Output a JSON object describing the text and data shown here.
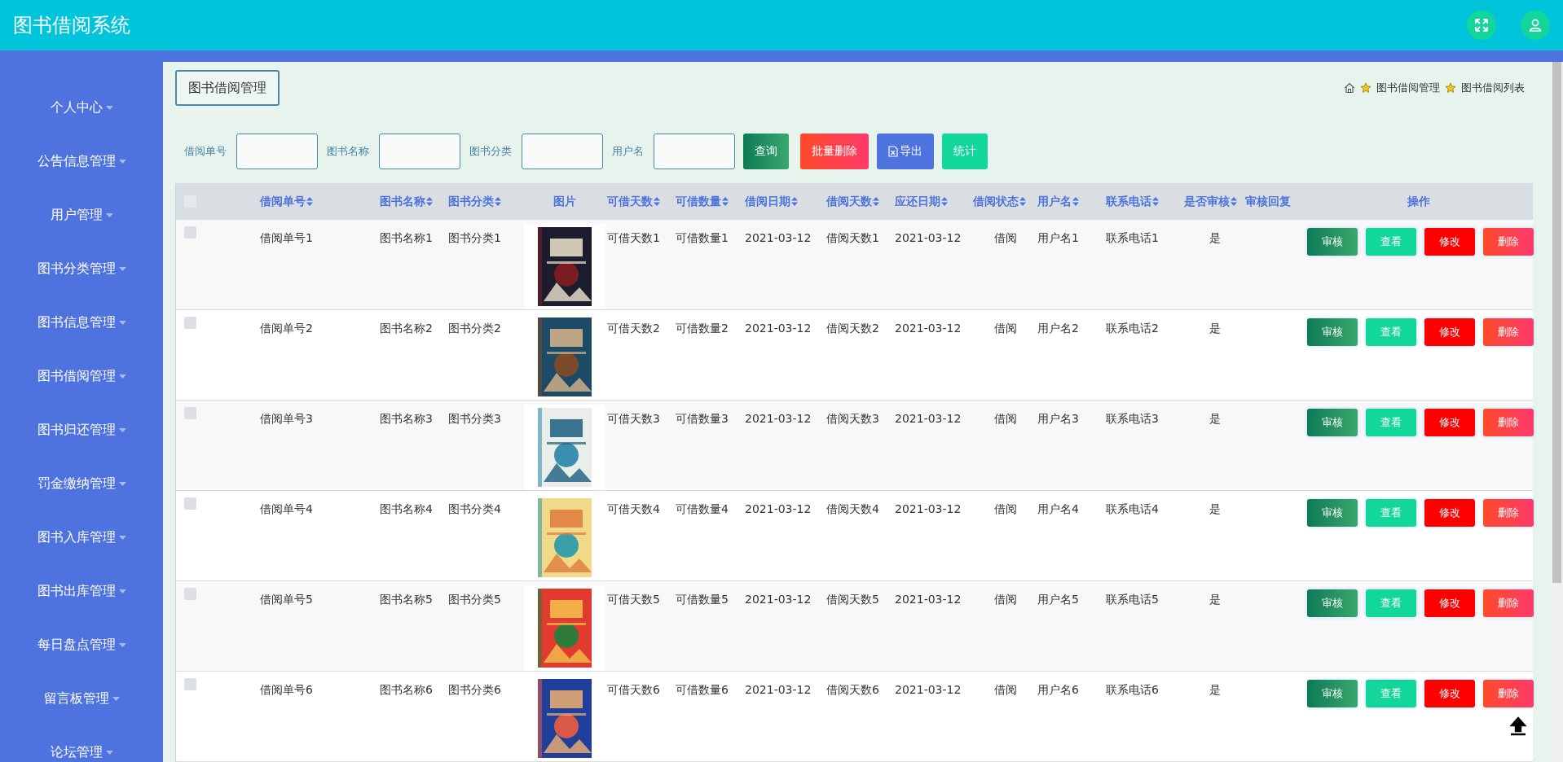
{
  "app": {
    "title": "图书借阅系统"
  },
  "sidebar": {
    "items": [
      {
        "label": "个人中心"
      },
      {
        "label": "公告信息管理"
      },
      {
        "label": "用户管理"
      },
      {
        "label": "图书分类管理"
      },
      {
        "label": "图书信息管理"
      },
      {
        "label": "图书借阅管理"
      },
      {
        "label": "图书归还管理"
      },
      {
        "label": "罚金缴纳管理"
      },
      {
        "label": "图书入库管理"
      },
      {
        "label": "图书出库管理"
      },
      {
        "label": "每日盘点管理"
      },
      {
        "label": "留言板管理"
      },
      {
        "label": "论坛管理"
      }
    ]
  },
  "page": {
    "title": "图书借阅管理",
    "breadcrumb": [
      "图书借阅管理",
      "图书借阅列表"
    ]
  },
  "search": {
    "fields": [
      {
        "label": "借阅单号"
      },
      {
        "label": "图书名称"
      },
      {
        "label": "图书分类"
      },
      {
        "label": "用户名"
      }
    ],
    "buttons": [
      {
        "label": "查询",
        "kind": "query"
      },
      {
        "label": "批量删除",
        "kind": "batch-delete"
      },
      {
        "label": "导出",
        "kind": "export"
      },
      {
        "label": "统计",
        "kind": "stats"
      }
    ]
  },
  "table": {
    "header_checked": false,
    "columns": [
      {
        "kind": "text",
        "label": "借阅单号",
        "sortable": true
      },
      {
        "kind": "text",
        "label": "图书名称",
        "sortable": true
      },
      {
        "kind": "text",
        "label": "图书分类",
        "sortable": true
      },
      {
        "label": "图片",
        "sortable": false
      },
      {
        "kind": "text",
        "label": "可借天数",
        "sortable": true
      },
      {
        "kind": "text",
        "label": "可借数量",
        "sortable": true
      },
      {
        "kind": "text",
        "label": "借阅日期",
        "sortable": true
      },
      {
        "kind": "text",
        "label": "借阅天数",
        "sortable": true
      },
      {
        "kind": "text",
        "label": "应还日期",
        "sortable": true
      },
      {
        "kind": "text",
        "label": "借阅状态",
        "sortable": true
      },
      {
        "kind": "text",
        "label": "用户名",
        "sortable": true
      },
      {
        "kind": "text",
        "label": "联系电话",
        "sortable": true
      },
      {
        "kind": "text",
        "label": "是否审核",
        "sortable": true
      },
      {
        "kind": "text",
        "label": "审核回复",
        "sortable": false
      },
      {
        "kind": "actions",
        "label": "操作",
        "sortable": false
      }
    ],
    "rows": [
      {
        "checked": false,
        "cells": [
          "借阅单号1",
          "图书名称1",
          "图书分类1",
          {
            "kind": "picture"
          },
          "可借天数1",
          "可借数量1",
          "2021-03-12",
          "借阅天数1",
          "2021-03-12",
          "借阅",
          "用户名1",
          "联系电话1",
          "是"
        ],
        "actions": [
          {
            "label": "审核",
            "kind": "audit"
          },
          {
            "label": "查看",
            "kind": "view"
          },
          {
            "label": "修改",
            "kind": "edit"
          },
          {
            "label": "删除",
            "kind": "delete"
          }
        ]
      },
      {
        "checked": false,
        "cells": [
          "借阅单号2",
          "图书名称2",
          "图书分类2",
          {
            "kind": "picture"
          },
          "可借天数2",
          "可借数量2",
          "2021-03-12",
          "借阅天数2",
          "2021-03-12",
          "借阅",
          "用户名2",
          "联系电话2",
          "是"
        ],
        "actions": [
          {
            "label": "审核",
            "kind": "audit"
          },
          {
            "label": "查看",
            "kind": "view"
          },
          {
            "label": "修改",
            "kind": "edit"
          },
          {
            "label": "删除",
            "kind": "delete"
          }
        ]
      },
      {
        "checked": false,
        "cells": [
          "借阅单号3",
          "图书名称3",
          "图书分类3",
          {
            "kind": "picture"
          },
          "可借天数3",
          "可借数量3",
          "2021-03-12",
          "借阅天数3",
          "2021-03-12",
          "借阅",
          "用户名3",
          "联系电话3",
          "是"
        ],
        "actions": [
          {
            "label": "审核",
            "kind": "audit"
          },
          {
            "label": "查看",
            "kind": "view"
          },
          {
            "label": "修改",
            "kind": "edit"
          },
          {
            "label": "删除",
            "kind": "delete"
          }
        ]
      },
      {
        "checked": false,
        "cells": [
          "借阅单号4",
          "图书名称4",
          "图书分类4",
          {
            "kind": "picture"
          },
          "可借天数4",
          "可借数量4",
          "2021-03-12",
          "借阅天数4",
          "2021-03-12",
          "借阅",
          "用户名4",
          "联系电话4",
          "是"
        ],
        "actions": [
          {
            "label": "审核",
            "kind": "audit"
          },
          {
            "label": "查看",
            "kind": "view"
          },
          {
            "label": "修改",
            "kind": "edit"
          },
          {
            "label": "删除",
            "kind": "delete"
          }
        ]
      },
      {
        "checked": false,
        "cells": [
          "借阅单号5",
          "图书名称5",
          "图书分类5",
          {
            "kind": "picture"
          },
          "可借天数5",
          "可借数量5",
          "2021-03-12",
          "借阅天数5",
          "2021-03-12",
          "借阅",
          "用户名5",
          "联系电话5",
          "是"
        ],
        "actions": [
          {
            "label": "审核",
            "kind": "audit"
          },
          {
            "label": "查看",
            "kind": "view"
          },
          {
            "label": "修改",
            "kind": "edit"
          },
          {
            "label": "删除",
            "kind": "delete"
          }
        ]
      },
      {
        "checked": false,
        "cells": [
          "借阅单号6",
          "图书名称6",
          "图书分类6",
          {
            "kind": "picture"
          },
          "可借天数6",
          "可借数量6",
          "2021-03-12",
          "借阅天数6",
          "2021-03-12",
          "借阅",
          "用户名6",
          "联系电话6",
          "是"
        ],
        "actions": [
          {
            "label": "审核",
            "kind": "audit"
          },
          {
            "label": "查看",
            "kind": "view"
          },
          {
            "label": "修改",
            "kind": "edit"
          },
          {
            "label": "删除",
            "kind": "delete"
          }
        ]
      }
    ]
  }
}
